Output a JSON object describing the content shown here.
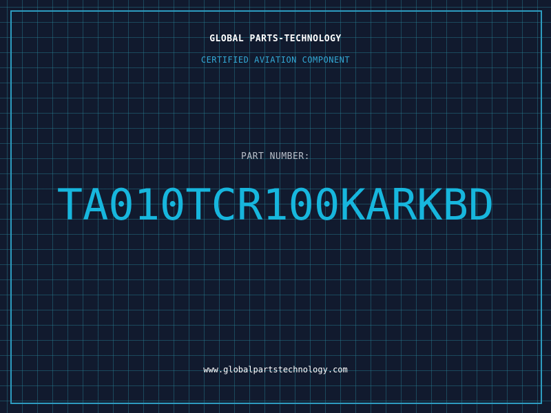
{
  "header": {
    "company": "GLOBAL PARTS-TECHNOLOGY",
    "subtitle": "CERTIFIED AVIATION COMPONENT"
  },
  "part": {
    "label": "PART NUMBER:",
    "number": "TA010TCR100KARKBD"
  },
  "footer": {
    "website": "www.globalpartstechnology.com"
  },
  "colors": {
    "background": "#111a2e",
    "grid": "#1f6b7c",
    "accent": "#17b6dd",
    "frame": "#2d9cc0"
  }
}
